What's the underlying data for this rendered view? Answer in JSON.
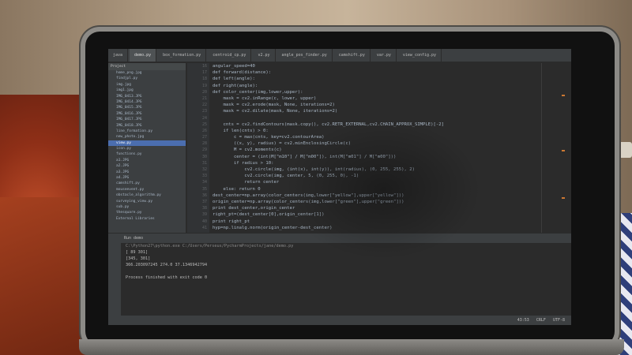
{
  "tabs": [
    "java",
    "demo.py",
    "box_formation.py",
    "centroid_cp.py",
    "v2.py",
    "angle_pos_finder.py",
    "camshift.py",
    "var.py",
    "view_config.py"
  ],
  "project": {
    "header": "Project",
    "items": [
      "home_png.jpg",
      "findjpl.py",
      "img.jpg",
      "img1.jpg",
      "IMG_0413.JPG",
      "IMG_0414.JPG",
      "IMG_0415.JPG",
      "IMG_0416.JPG",
      "IMG_0417.JPG",
      "IMG_0418.JPG",
      "line_formation.py",
      "new_photo.jpg",
      "view.py",
      "icon.py",
      "functions.py",
      "a1.JPG",
      "a2.JPG",
      "a3.JPG",
      "a4.JPG",
      "camshift.py",
      "mouseevent.py",
      "obstacle_algorithm.py",
      "surveying_view.py",
      "sub.py",
      "thesquare.py",
      "External Libraries"
    ],
    "selected_index": 12
  },
  "line_numbers": [
    "16",
    "17",
    "18",
    "19",
    "20",
    "21",
    "22",
    "23",
    "24",
    "25",
    "26",
    "27",
    "28",
    "29",
    "30",
    "31",
    "32",
    "33",
    "34",
    "35",
    "36",
    "37",
    "38",
    "39",
    "40",
    "41"
  ],
  "code": [
    "angular_speed=40",
    "def forward(distance):",
    "def left(angle):",
    "def right(angle):",
    "def color_center(img,lower,upper):",
    "    mask = cv2.inRange(c, lower, upper)",
    "    mask = cv2.erode(mask, None, iterations=2)",
    "    mask = cv2.dilate(mask, None, iterations=2)",
    "",
    "    cnts = cv2.findContours(mask.copy(), cv2.RETR_EXTERNAL,cv2.CHAIN_APPROX_SIMPLE)[-2]",
    "    if len(cnts) > 0:",
    "        c = max(cnts, key=cv2.contourArea)",
    "        ((x, y), radius) = cv2.minEnclosingCircle(c)",
    "        M = cv2.moments(c)",
    "        center = (int(M[\"m10\"] / M[\"m00\"]), int(M[\"m01\"] / M[\"m00\"]))",
    "        if radius > 10:",
    "            cv2.circle(img, (int(x), int(y)), int(radius), (0, 255, 255), 2)",
    "            cv2.circle(img, center, 5, (0, 255, 0), -1)",
    "            return center",
    "    else: return 0",
    "dest_center=np.array(color_centers(img,lower[\"yellow\"],upper[\"yellow\"]))",
    "origin_center=np.array(color_centers(img,lower[\"green\"],upper[\"green\"]))",
    "print dest_center,origin_center",
    "right_pt=(dest_center[0],origin_center[1])",
    "print right_pt",
    "hyp=np.linalg.norm(origin_center-dest_center)"
  ],
  "run": {
    "label": "Run",
    "config": "demo"
  },
  "console": {
    "command": "C:\\Python27\\python.exe C:/Users/Perseus/PycharmProjects/jane/demo.py",
    "lines": [
      "[ 89 301]",
      "[345, 301]",
      "366.203097245 274.0 37.1346942794",
      "",
      "Process finished with exit code 0"
    ]
  },
  "status": {
    "position": "43:53",
    "line_sep": "CRLF",
    "encoding": "UTF-8"
  }
}
